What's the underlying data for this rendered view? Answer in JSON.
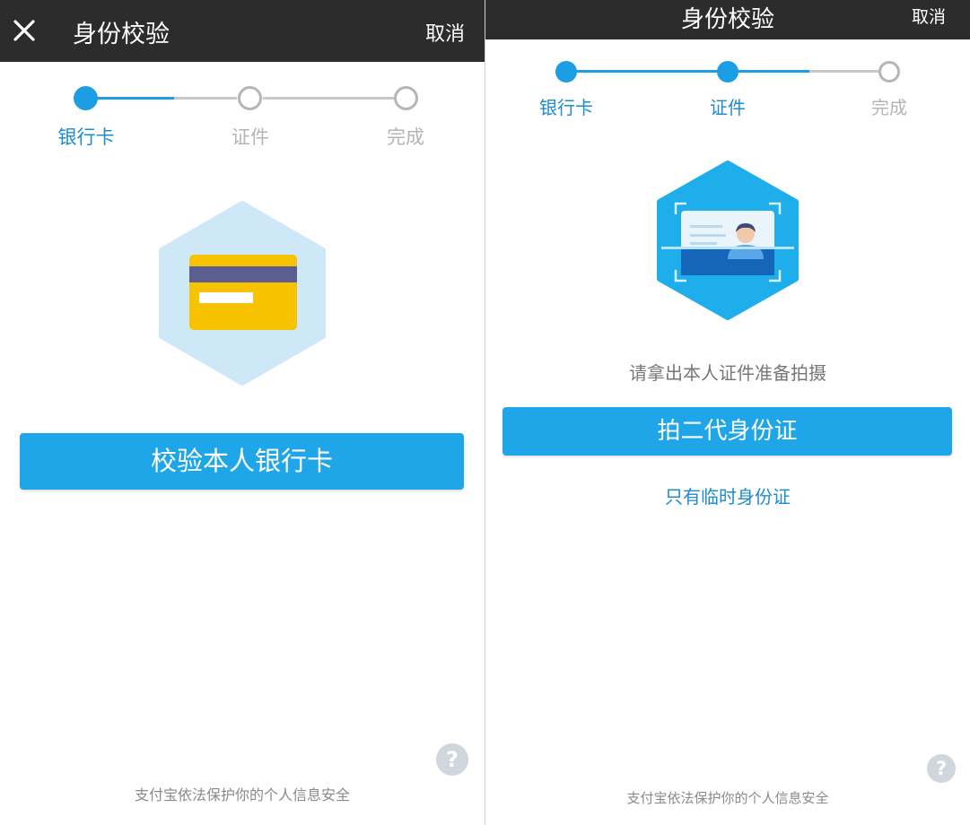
{
  "left": {
    "navbar": {
      "title": "身份校验",
      "cancel_label": "取消"
    },
    "steps": [
      {
        "label": "银行卡"
      },
      {
        "label": "证件"
      },
      {
        "label": "完成"
      }
    ],
    "primary_button_label": "校验本人银行卡",
    "footer_note": "支付宝依法保护你的个人信息安全",
    "help_label": "?"
  },
  "right": {
    "navbar": {
      "title": "身份校验",
      "cancel_label": "取消"
    },
    "steps": [
      {
        "label": "银行卡"
      },
      {
        "label": "证件"
      },
      {
        "label": "完成"
      }
    ],
    "hint_text": "请拿出本人证件准备拍摄",
    "primary_button_label": "拍二代身份证",
    "link_label": "只有临时身份证",
    "footer_note": "支付宝依法保护你的个人信息安全",
    "help_label": "?"
  },
  "colors": {
    "navbar_bg": "#2c2c2c",
    "accent": "#1c9fe2",
    "button_bg": "#1fa6e8",
    "inactive_step": "#b5b5b5",
    "card_yellow": "#f7c300",
    "card_stripe": "#5b5f8f",
    "hex_light": "#cfe8f8",
    "hex_blue": "#1daeeb"
  },
  "icons": {
    "close": "close-icon",
    "bank_card": "bank-card-icon",
    "id_card": "id-card-scan-icon",
    "help": "help-icon"
  }
}
